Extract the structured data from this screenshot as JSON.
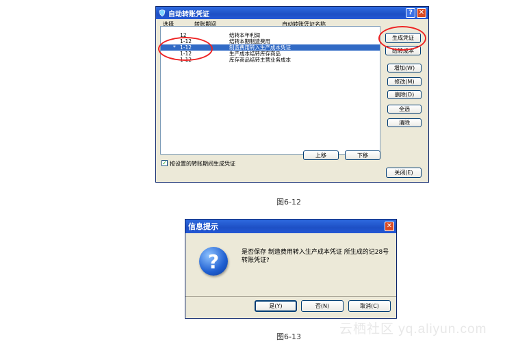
{
  "dialog1": {
    "title": "自动转账凭证",
    "columns": {
      "select": "选择",
      "period": "转账期间",
      "name": "自动转账凭证名称"
    },
    "rows": [
      {
        "select": "",
        "period": "12",
        "name": "结转本年利润"
      },
      {
        "select": "",
        "period": "1-12",
        "name": "结转本期制造费用"
      },
      {
        "select": "*",
        "period": "1-12",
        "name": "制造费用转入生产成本凭证"
      },
      {
        "select": "",
        "period": "1-12",
        "name": "生产成本结转库存商品"
      },
      {
        "select": "",
        "period": "1-12",
        "name": "库存商品结转主营业务成本"
      }
    ],
    "selected_row": 3,
    "checkbox_label": "按设置的转账期间生成凭证",
    "checkbox_checked": true,
    "buttons": {
      "generate": "生成凭证",
      "transfer_cost": "结转成本",
      "add": "增加(W)",
      "edit": "修改(M)",
      "delete": "删除(D)",
      "select_all": "全选",
      "clear": "清除",
      "move_up": "上移",
      "move_down": "下移",
      "close": "关闭(E)"
    },
    "help_glyph": "?",
    "close_glyph": "✕"
  },
  "caption1": "图6-12",
  "dialog2": {
    "title": "信息提示",
    "icon_glyph": "?",
    "message": "是否保存 制造费用转入生产成本凭证 所生成的记28号转账凭证?",
    "buttons": {
      "yes": "是(Y)",
      "no": "否(N)",
      "cancel": "取消(C)"
    },
    "close_glyph": "✕"
  },
  "caption2": "图6-13",
  "watermark": "云栖社区 yq.aliyun.com",
  "colors": {
    "titlebar": "#2458d6",
    "selection": "#316ac5",
    "annotation": "#e22222"
  }
}
